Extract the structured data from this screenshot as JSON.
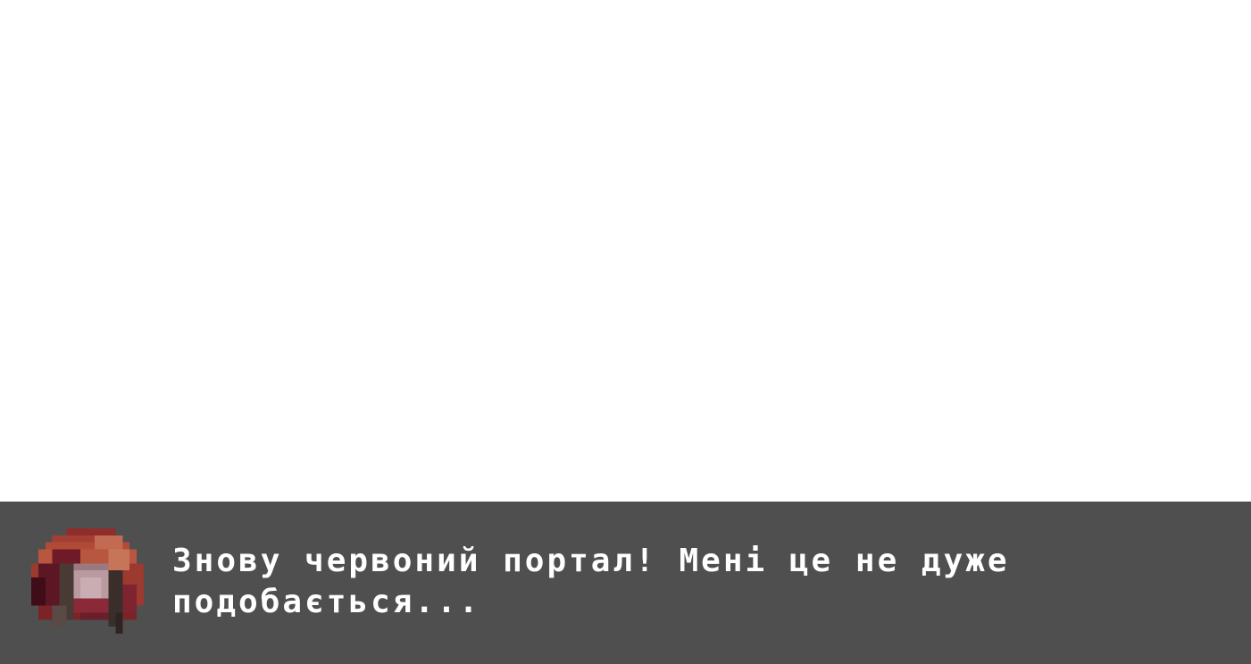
{
  "scene": {
    "background": "#ffffff"
  },
  "dialog": {
    "background": "#4f4f4f",
    "speaker_portrait_icon": "red-hooded-character-portrait",
    "text": "Знову червоний портал! Мені це не дуже\nподобається...",
    "text_color": "#ffffff"
  }
}
